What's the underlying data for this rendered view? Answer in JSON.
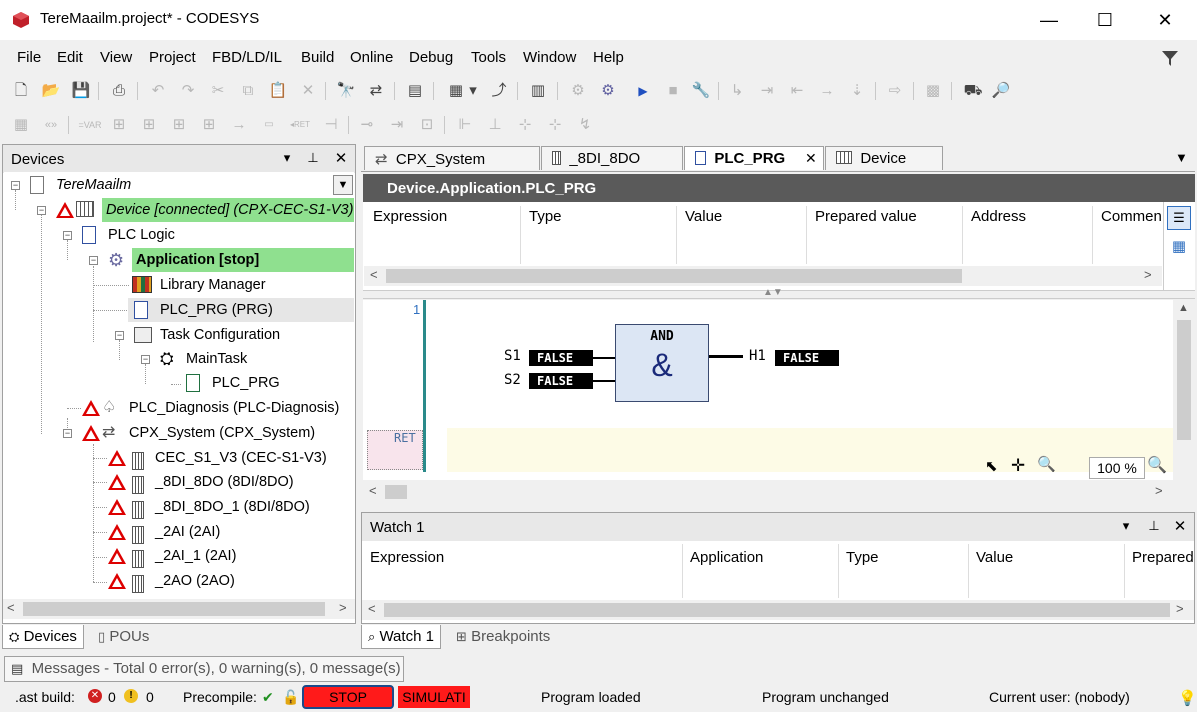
{
  "window": {
    "title": "TereMaailm.project* - CODESYS",
    "minimize": "—",
    "maximize": "☐",
    "close": "✕"
  },
  "menu": [
    "File",
    "Edit",
    "View",
    "Project",
    "FBD/LD/IL",
    "Build",
    "Online",
    "Debug",
    "Tools",
    "Window",
    "Help"
  ],
  "devices_panel": {
    "title": "Devices",
    "root": "TereMaailm",
    "tree": {
      "device": "Device [connected] (CPX-CEC-S1-V3)",
      "plc_logic": "PLC Logic",
      "application": "Application [stop]",
      "library_manager": "Library Manager",
      "plc_prg": "PLC_PRG (PRG)",
      "task_config": "Task Configuration",
      "main_task": "MainTask",
      "main_task_prg": "PLC_PRG",
      "plc_diagnosis": "PLC_Diagnosis (PLC-Diagnosis)",
      "cpx_system": "CPX_System (CPX_System)",
      "modules": [
        "CEC_S1_V3 (CEC-S1-V3)",
        "_8DI_8DO (8DI/8DO)",
        "_8DI_8DO_1 (8DI/8DO)",
        "_2AI (2AI)",
        "_2AI_1 (2AI)",
        "_2AO (2AO)"
      ]
    },
    "bottom_tabs": [
      "Devices",
      "POUs"
    ]
  },
  "editor": {
    "tabs": [
      "CPX_System",
      "_8DI_8DO",
      "PLC_PRG",
      "Device"
    ],
    "path": "Device.Application.PLC_PRG",
    "columns": [
      "Expression",
      "Type",
      "Value",
      "Prepared value",
      "Address",
      "Commen"
    ],
    "fbd": {
      "line_number": "1",
      "block_type": "AND",
      "block_symbol": "&",
      "inputs": [
        {
          "name": "S1",
          "value": "FALSE"
        },
        {
          "name": "S2",
          "value": "FALSE"
        }
      ],
      "output": {
        "name": "H1",
        "value": "FALSE"
      },
      "ret_label": "RET"
    },
    "zoom": "100 %"
  },
  "watch_panel": {
    "title": "Watch 1",
    "columns": [
      "Expression",
      "Application",
      "Type",
      "Value",
      "Prepared"
    ],
    "tabs": [
      "Watch 1",
      "Breakpoints"
    ]
  },
  "messages": {
    "text": "Messages - Total 0 error(s), 0 warning(s), 0 message(s)"
  },
  "statusbar": {
    "last_build": ".ast build:",
    "errors": "0",
    "warnings": "0",
    "precompile": "Precompile:",
    "stop": "STOP",
    "simulation": "SIMULATI",
    "program_loaded": "Program loaded",
    "program_unchanged": "Program unchanged",
    "current_user": "Current user: (nobody)"
  },
  "colors": {
    "connected_green": "#8fe08f",
    "stop_red": "#ff1a1a",
    "header_gray": "#5a5a5a"
  }
}
